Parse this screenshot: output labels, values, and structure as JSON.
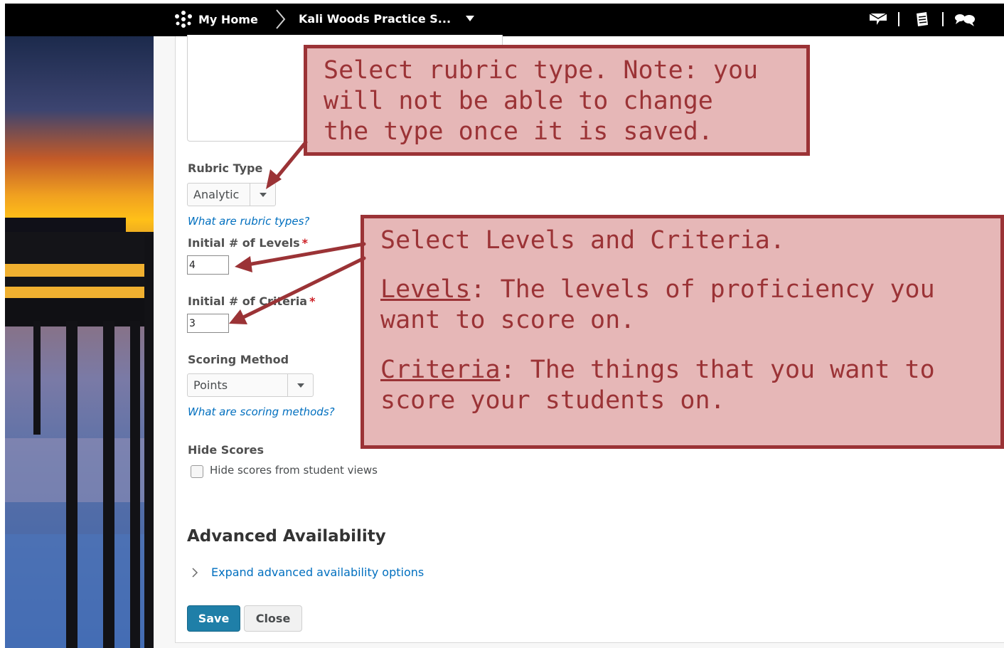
{
  "colors": {
    "navbar": "#000000",
    "link": "#006fbf",
    "primary_button": "#1f7fa8",
    "callout_fill": "#e6b7b7",
    "callout_border": "#9b3336",
    "required": "#cd2026"
  },
  "navbar": {
    "home_label": "My Home",
    "course_label": "Kali Woods Practice S...",
    "icons": [
      "org-logo-icon",
      "chevron-right-icon",
      "dropdown-caret-icon",
      "message-icon",
      "assignment-icon",
      "discussion-icon"
    ]
  },
  "form": {
    "rubric_type": {
      "label": "Rubric Type",
      "value": "Analytic",
      "help": "What are rubric types?"
    },
    "levels": {
      "label": "Initial # of Levels",
      "required_mark": "*",
      "value": "4"
    },
    "criteria": {
      "label": "Initial # of Criteria",
      "required_mark": "*",
      "value": "3"
    },
    "scoring": {
      "label": "Scoring Method",
      "value": "Points",
      "help": "What are scoring methods?"
    },
    "hide_scores": {
      "label": "Hide Scores",
      "checkbox_label": "Hide scores from student views",
      "checked": false
    }
  },
  "advanced": {
    "heading": "Advanced Availability",
    "expand_link": "Expand advanced availability options"
  },
  "buttons": {
    "save": "Save",
    "close": "Close"
  },
  "callouts": {
    "rubric_type": {
      "line1": "Select rubric type. Note: you",
      "line2": "will not be able to change",
      "line3": "the type once it is saved."
    },
    "levels_criteria": {
      "intro": "Select Levels and Criteria.",
      "levels_term": "Levels",
      "levels_line1": ": The levels of proficiency you",
      "levels_line2": "want to score on.",
      "criteria_term": "Criteria",
      "criteria_line1": ": The things that you want to",
      "criteria_line2": "score your students on."
    }
  }
}
